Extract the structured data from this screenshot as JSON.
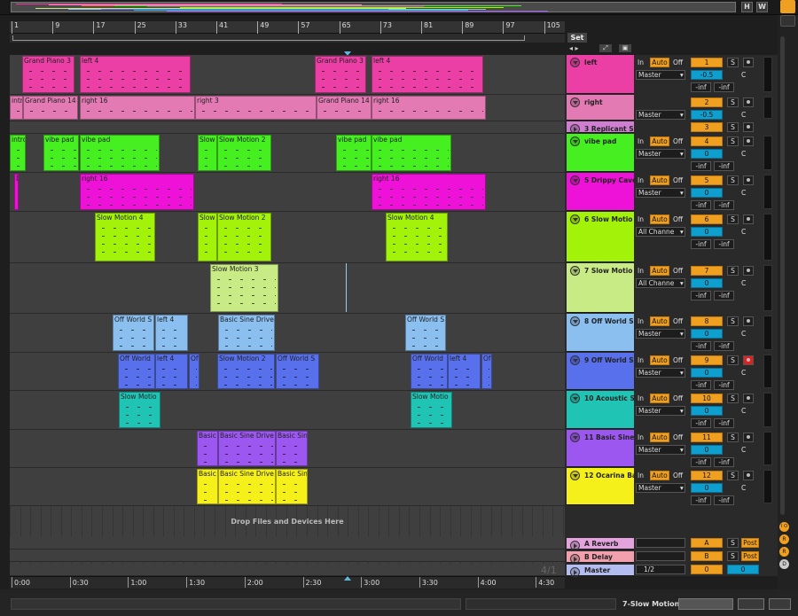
{
  "overview": {
    "buttons": [
      "H",
      "W"
    ],
    "band_colors": [
      "#ec3fa6",
      "#f18db0",
      "#ea6a50",
      "#46ef1f",
      "#ee11d7",
      "#a3f20a",
      "#c9eb85",
      "#8bbff0",
      "#5870ec",
      "#20c4b5",
      "#9c57f0",
      "#f5ef1a"
    ]
  },
  "set_header": {
    "label": "Set"
  },
  "ruler": {
    "bars": [
      "1",
      "9",
      "17",
      "25",
      "33",
      "41",
      "49",
      "57",
      "65",
      "73",
      "81",
      "89",
      "97",
      "105"
    ]
  },
  "time_ruler": {
    "times": [
      "0:00",
      "0:30",
      "1:00",
      "1:30",
      "2:00",
      "2:30",
      "3:00",
      "3:30",
      "4:00",
      "4:30"
    ]
  },
  "time_signature": "4/1",
  "drop_text": "Drop Files and Devices Here",
  "status": {
    "selected_track": "7-Slow Motion"
  },
  "tracks": [
    {
      "name": "left",
      "number": "1",
      "color": "#ec3fa6",
      "fold": "down",
      "input": "In",
      "auto": "Auto",
      "off": "Off",
      "routing": "Master",
      "pan": "-0.5",
      "vol_l": "-inf",
      "vol_r": "-inf",
      "armed": false,
      "has_input_row": true,
      "clips": [
        {
          "title": "Grand Piano 3"
        },
        {
          "title": "left 4"
        },
        {
          "title": "Grand Piano 3"
        },
        {
          "title": "left 4"
        }
      ]
    },
    {
      "name": "right",
      "number": "2",
      "color": "#e37ab4",
      "fold": "down",
      "input": "",
      "auto": "",
      "off": "",
      "routing": "Master",
      "pan": "-0.5",
      "vol_l": "",
      "vol_r": "",
      "armed": false,
      "has_input_row": false,
      "clips": [
        {
          "title": "intro"
        },
        {
          "title": "Grand Piano 14"
        },
        {
          "title": "right 16"
        },
        {
          "title": "right 3"
        },
        {
          "title": "Grand Piano 14"
        },
        {
          "title": "right 16"
        }
      ]
    },
    {
      "name": "3 Replicant S",
      "number": "3",
      "color": "#d07ed2",
      "fold": "right",
      "input": "",
      "auto": "",
      "off": "",
      "routing": "",
      "pan": "",
      "vol_l": "",
      "vol_r": "",
      "armed": false,
      "has_input_row": false,
      "clips": []
    },
    {
      "name": "vibe pad",
      "number": "4",
      "color": "#46ef1f",
      "fold": "down",
      "input": "In",
      "auto": "Auto",
      "off": "Off",
      "routing": "Master",
      "pan": "0",
      "vol_l": "-inf",
      "vol_r": "-inf",
      "armed": false,
      "has_input_row": true,
      "clips": [
        {
          "title": "intro"
        },
        {
          "title": "vibe pad"
        },
        {
          "title": "vibe pad"
        },
        {
          "title": "Slow"
        },
        {
          "title": "Slow Motion 2"
        },
        {
          "title": "vibe pad"
        },
        {
          "title": "vibe pad"
        }
      ]
    },
    {
      "name": "5 Drippy Cave",
      "number": "5",
      "color": "#ee11d7",
      "fold": "down",
      "input": "In",
      "auto": "Auto",
      "off": "Off",
      "routing": "Master",
      "pan": "0",
      "vol_l": "-inf",
      "vol_r": "-inf",
      "armed": false,
      "has_input_row": true,
      "clips": [
        {
          "title": "D"
        },
        {
          "title": "right 16"
        },
        {
          "title": "right 16"
        }
      ]
    },
    {
      "name": "6 Slow Motio",
      "number": "6",
      "color": "#a3f20a",
      "fold": "down",
      "input": "In",
      "auto": "Auto",
      "off": "Off",
      "routing": "All Channe",
      "pan": "0",
      "vol_l": "-inf",
      "vol_r": "-inf",
      "armed": false,
      "has_input_row": true,
      "clips": [
        {
          "title": "Slow Motion 4"
        },
        {
          "title": "Slow"
        },
        {
          "title": "Slow Motion 2"
        },
        {
          "title": "Slow Motion 4"
        }
      ]
    },
    {
      "name": "7 Slow Motio",
      "number": "7",
      "color": "#c9eb85",
      "fold": "down",
      "input": "In",
      "auto": "Auto",
      "off": "Off",
      "routing": "All Channe",
      "pan": "0",
      "vol_l": "-inf",
      "vol_r": "-inf",
      "armed": false,
      "has_input_row": true,
      "clips": [
        {
          "title": "Slow Motion 3"
        }
      ]
    },
    {
      "name": "8 Off World S",
      "number": "8",
      "color": "#8bbff0",
      "fold": "down",
      "input": "In",
      "auto": "Auto",
      "off": "Off",
      "routing": "Master",
      "pan": "0",
      "vol_l": "-inf",
      "vol_r": "-inf",
      "armed": false,
      "has_input_row": true,
      "clips": [
        {
          "title": "Off World S"
        },
        {
          "title": "left 4"
        },
        {
          "title": "Basic Sine Drive"
        },
        {
          "title": "Off World S"
        }
      ]
    },
    {
      "name": "9 Off World S",
      "number": "9",
      "color": "#5870ec",
      "fold": "down",
      "input": "In",
      "auto": "Auto",
      "off": "Off",
      "routing": "Master",
      "pan": "0",
      "vol_l": "-inf",
      "vol_r": "-inf",
      "armed": true,
      "has_input_row": true,
      "clips": [
        {
          "title": "Off World"
        },
        {
          "title": "left 4"
        },
        {
          "title": "Of"
        },
        {
          "title": "Slow Motion 2"
        },
        {
          "title": "Off World S"
        },
        {
          "title": "Off World"
        },
        {
          "title": "left 4"
        },
        {
          "title": "Of"
        }
      ]
    },
    {
      "name": "10 Acoustic S",
      "number": "10",
      "color": "#20c4b5",
      "fold": "down",
      "input": "In",
      "auto": "Auto",
      "off": "Off",
      "routing": "Master",
      "pan": "0",
      "vol_l": "-inf",
      "vol_r": "-inf",
      "armed": false,
      "has_input_row": true,
      "clips": [
        {
          "title": "Slow Motio"
        },
        {
          "title": "Slow Motio"
        }
      ]
    },
    {
      "name": "11 Basic Sine",
      "number": "11",
      "color": "#9c57f0",
      "fold": "down",
      "input": "In",
      "auto": "Auto",
      "off": "Off",
      "routing": "Master",
      "pan": "0",
      "vol_l": "-inf",
      "vol_r": "-inf",
      "armed": false,
      "has_input_row": true,
      "clips": [
        {
          "title": "Basic"
        },
        {
          "title": "Basic Sine Drive"
        },
        {
          "title": "Basic Sin"
        }
      ]
    },
    {
      "name": "12 Ocarina Ba",
      "number": "12",
      "color": "#f5ef1a",
      "fold": "down",
      "input": "In",
      "auto": "Auto",
      "off": "Off",
      "routing": "Master",
      "pan": "0",
      "vol_l": "-inf",
      "vol_r": "-inf",
      "armed": false,
      "has_input_row": true,
      "clips": [
        {
          "title": "Basic"
        },
        {
          "title": "Basic Sine Drive"
        },
        {
          "title": "Basic Sin"
        }
      ]
    }
  ],
  "returns": [
    {
      "name": "A Reverb",
      "send": "A",
      "solo": "S",
      "post": "Post",
      "color": "#e5a3de"
    },
    {
      "name": "B Delay",
      "send": "B",
      "solo": "S",
      "post": "Post",
      "color": "#f2a0ae"
    },
    {
      "name": "Master",
      "routing": "1/2",
      "val1": "0",
      "val2": "0",
      "color": "#b3bdf2"
    }
  ],
  "solo_label": "S",
  "center_label": "C",
  "right_icons": [
    "I O",
    "R",
    "R",
    "D"
  ]
}
